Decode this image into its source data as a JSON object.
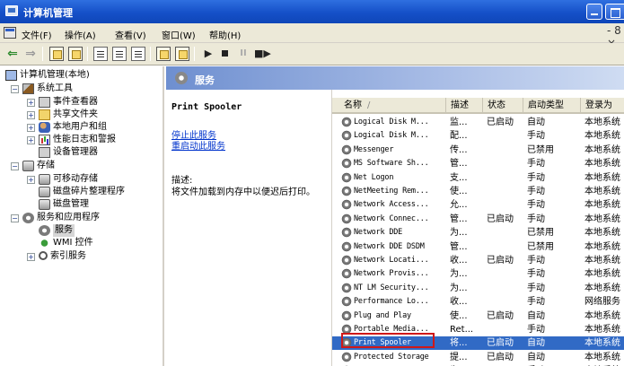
{
  "window": {
    "title": "计算机管理"
  },
  "menu": {
    "items": [
      "文件(F)",
      "操作(A)",
      "查看(V)",
      "窗口(W)",
      "帮助(H)"
    ],
    "close_glyph": "- 8 ×"
  },
  "toolbar": {
    "icons": [
      "back-arrow-icon",
      "forward-arrow-icon",
      "up-folder-icon",
      "show-hide-tree-icon",
      "properties-icon",
      "export-list-icon",
      "help-icon",
      "refresh-icon",
      "view-icon",
      "play-icon",
      "stop-icon",
      "pause-icon",
      "restart-icon"
    ]
  },
  "tree": {
    "root": "计算机管理(本地)",
    "system_tools": "系统工具",
    "event_viewer": "事件查看器",
    "shared_folders": "共享文件夹",
    "local_users": "本地用户和组",
    "perf_logs": "性能日志和警报",
    "device_manager": "设备管理器",
    "storage": "存储",
    "removable": "可移动存储",
    "defrag": "磁盘碎片整理程序",
    "disk_mgmt": "磁盘管理",
    "services_apps": "服务和应用程序",
    "services": "服务",
    "wmi": "WMI 控件",
    "indexing": "索引服务"
  },
  "right_header": {
    "title": "服务"
  },
  "detail": {
    "service_name": "Print Spooler",
    "stop_link": "停止此服务",
    "restart_link": "重启动此服务",
    "desc_label": "描述:",
    "desc_text": "将文件加载到内存中以便迟后打印。"
  },
  "list": {
    "columns": [
      "名称",
      "描述",
      "状态",
      "启动类型",
      "登录为"
    ],
    "sort_arrow": "/",
    "rows": [
      {
        "name": "Logical Disk M...",
        "desc": "监...",
        "status": "已启动",
        "stype": "自动",
        "logon": "本地系统"
      },
      {
        "name": "Logical Disk M...",
        "desc": "配...",
        "status": "",
        "stype": "手动",
        "logon": "本地系统"
      },
      {
        "name": "Messenger",
        "desc": "传...",
        "status": "",
        "stype": "已禁用",
        "logon": "本地系统"
      },
      {
        "name": "MS Software Sh...",
        "desc": "管...",
        "status": "",
        "stype": "手动",
        "logon": "本地系统"
      },
      {
        "name": "Net Logon",
        "desc": "支...",
        "status": "",
        "stype": "手动",
        "logon": "本地系统"
      },
      {
        "name": "NetMeeting Rem...",
        "desc": "使...",
        "status": "",
        "stype": "手动",
        "logon": "本地系统"
      },
      {
        "name": "Network Access...",
        "desc": "允...",
        "status": "",
        "stype": "手动",
        "logon": "本地系统"
      },
      {
        "name": "Network Connec...",
        "desc": "管...",
        "status": "已启动",
        "stype": "手动",
        "logon": "本地系统"
      },
      {
        "name": "Network DDE",
        "desc": "为...",
        "status": "",
        "stype": "已禁用",
        "logon": "本地系统"
      },
      {
        "name": "Network DDE DSDM",
        "desc": "管...",
        "status": "",
        "stype": "已禁用",
        "logon": "本地系统"
      },
      {
        "name": "Network Locati...",
        "desc": "收...",
        "status": "已启动",
        "stype": "手动",
        "logon": "本地系统"
      },
      {
        "name": "Network Provis...",
        "desc": "为...",
        "status": "",
        "stype": "手动",
        "logon": "本地系统"
      },
      {
        "name": "NT LM Security...",
        "desc": "为...",
        "status": "",
        "stype": "手动",
        "logon": "本地系统"
      },
      {
        "name": "Performance Lo...",
        "desc": "收...",
        "status": "",
        "stype": "手动",
        "logon": "网络服务"
      },
      {
        "name": "Plug and Play",
        "desc": "使...",
        "status": "已启动",
        "stype": "自动",
        "logon": "本地系统"
      },
      {
        "name": "Portable Media...",
        "desc": "Ret...",
        "status": "",
        "stype": "手动",
        "logon": "本地系统"
      },
      {
        "name": "Print Spooler",
        "desc": "将...",
        "status": "已启动",
        "stype": "自动",
        "logon": "本地系统"
      },
      {
        "name": "Protected Storage",
        "desc": "提...",
        "status": "已启动",
        "stype": "自动",
        "logon": "本地系统"
      },
      {
        "name": "QoS RSVP",
        "desc": "为...",
        "status": "",
        "stype": "手动",
        "logon": "本地系统"
      }
    ]
  }
}
